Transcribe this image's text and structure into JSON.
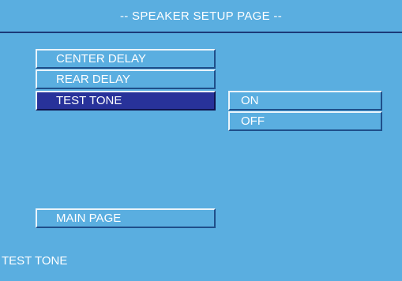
{
  "title": "-- SPEAKER SETUP PAGE --",
  "menu": {
    "items": [
      {
        "label": "CENTER DELAY"
      },
      {
        "label": "REAR DELAY"
      },
      {
        "label": "TEST TONE"
      }
    ],
    "selected": "TEST TONE",
    "main_page_label": "MAIN PAGE"
  },
  "options": {
    "items": [
      {
        "label": "ON"
      },
      {
        "label": "OFF"
      }
    ]
  },
  "status": {
    "text": "TEST TONE"
  },
  "colors": {
    "background": "#5aaee0",
    "selected": "#28329a",
    "title_rule": "#1c3a78",
    "text": "#ffffff"
  }
}
